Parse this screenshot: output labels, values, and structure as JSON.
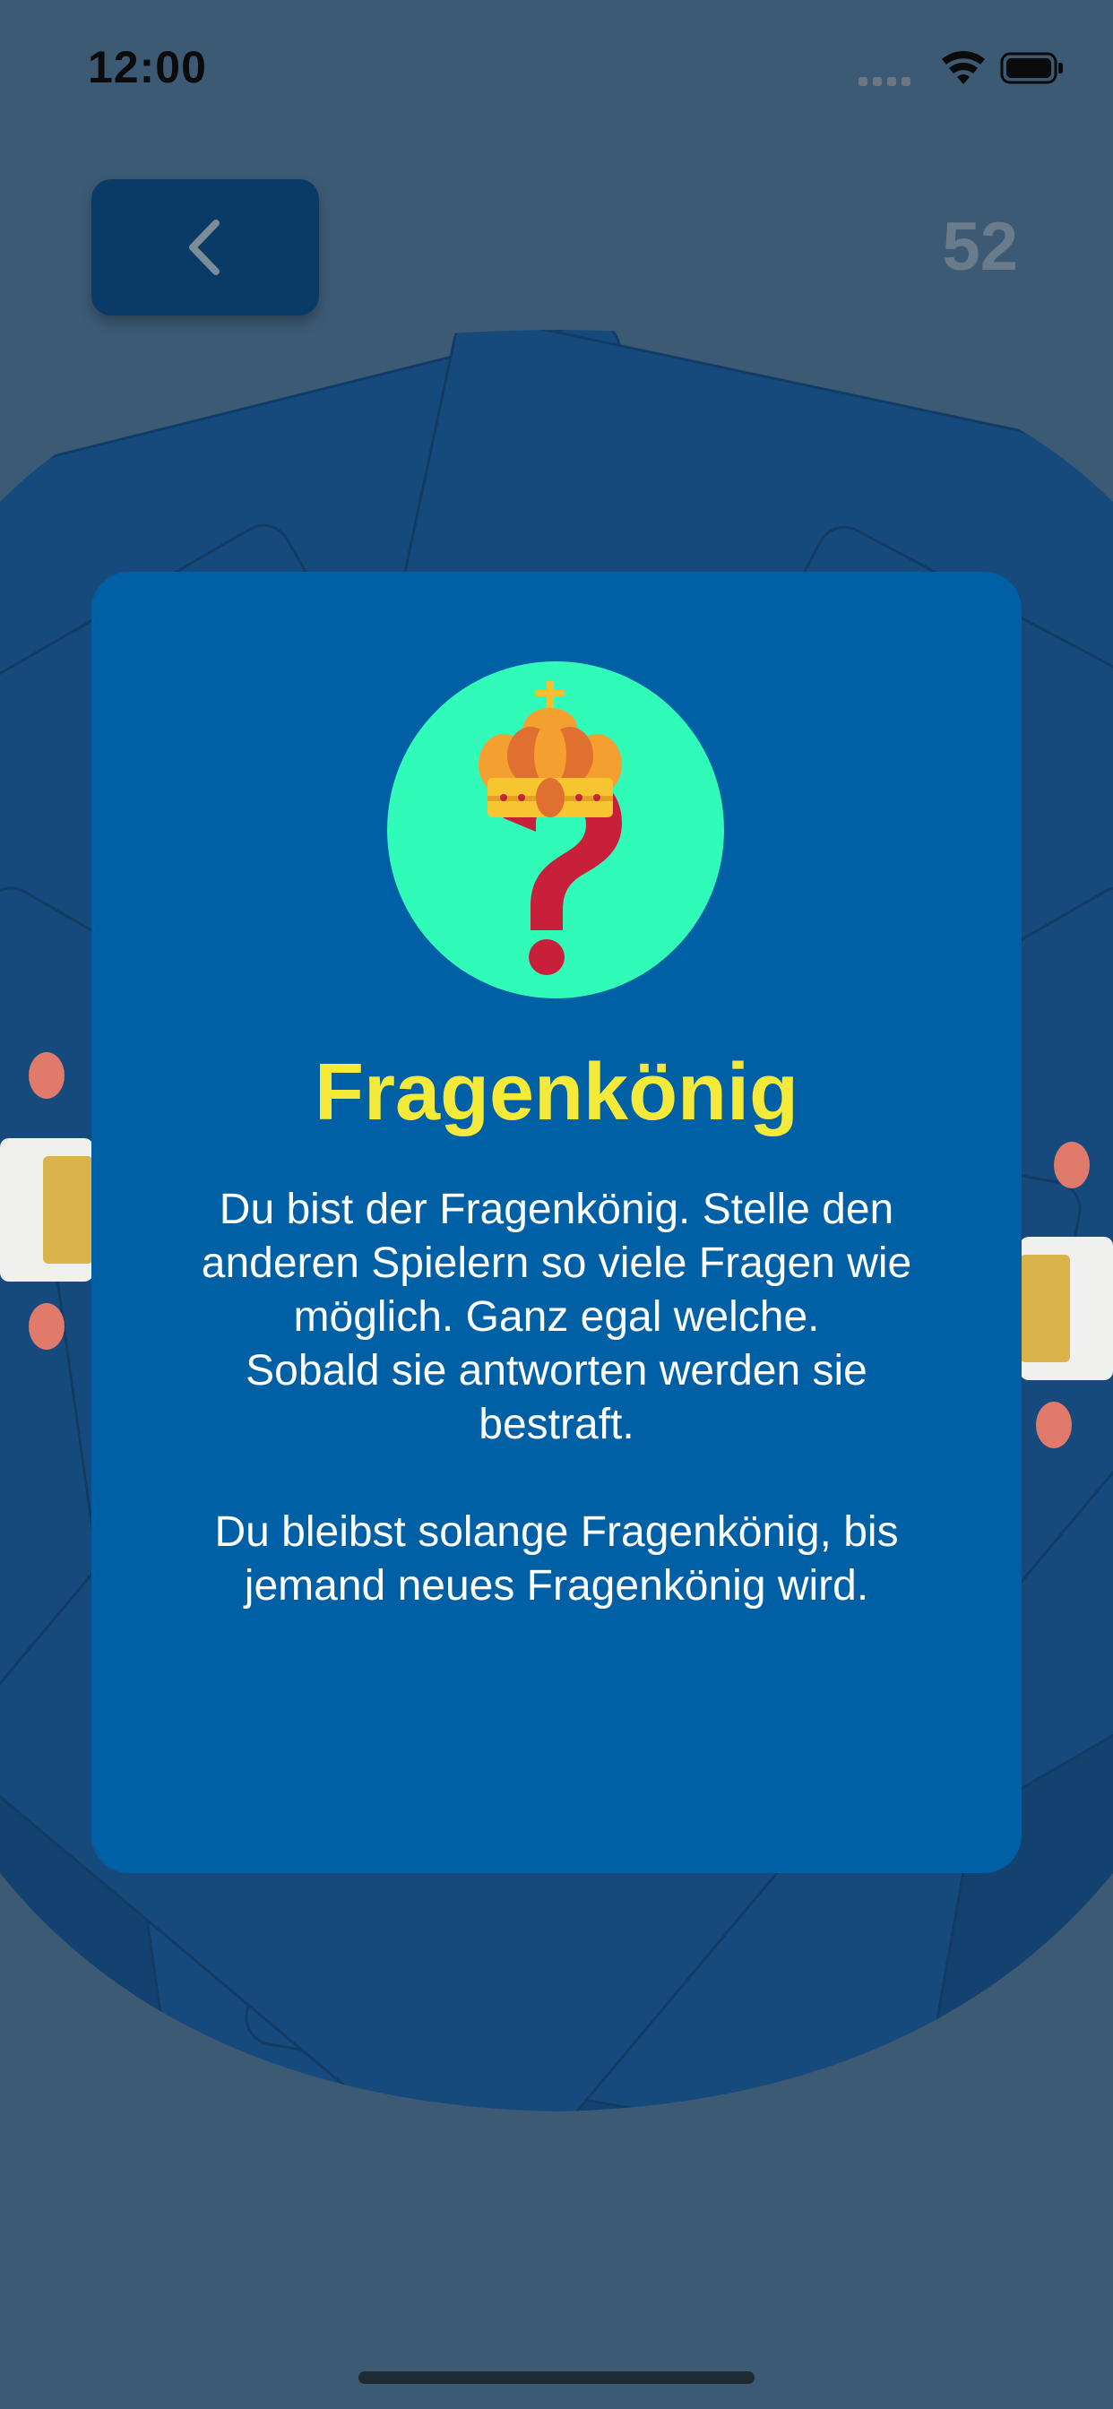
{
  "status_bar": {
    "time": "12:00"
  },
  "header": {
    "back_icon": "chevron-left-icon",
    "counter": "52"
  },
  "card": {
    "icon": "crown-question-mark-icon",
    "title": "Fragenkönig",
    "text": "Du bist der Fragenkönig. Stelle den anderen Spielern so viele Fragen wie möglich. Ganz egal welche.\nSobald sie antworten werden sie bestraft.\n\nDu bleibst solange Fragenkönig, bis jemand neues Fragenkönig wird."
  },
  "colors": {
    "background": "#3d5a75",
    "card": "#0060a6",
    "back_button": "#0a3b66",
    "title": "#f5ea3a",
    "icon_circle": "#31fbb9",
    "question_mark": "#c8203a"
  }
}
